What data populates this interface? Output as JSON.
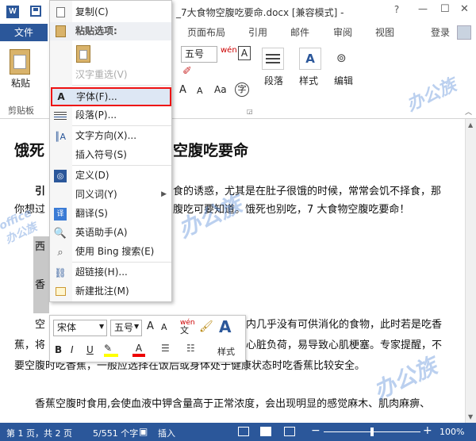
{
  "window": {
    "title": "_7大食物空腹吃要命.docx [兼容模式] -",
    "help": "?",
    "controls": [
      "—",
      "☐",
      "✕"
    ]
  },
  "quick_access": {
    "save_icon": "save-icon",
    "word_logo": "W"
  },
  "tabs": {
    "file": "文件",
    "layout": "页面布局",
    "references": "引用",
    "mailings": "邮件",
    "review": "审阅",
    "view": "视图",
    "login": "登录"
  },
  "ribbon": {
    "paste": "粘贴",
    "clipboard": "剪贴板",
    "font_size": "五号",
    "paragraph": "段落",
    "styles": "样式",
    "editing": "编辑"
  },
  "document": {
    "heading_left": "饿死",
    "heading_right": "空腹吃要命",
    "p1_start": "引",
    "p1_line1": "食的诱惑，尤其是在肚子很饿的时候，常常会饥不择食，那",
    "p1_line2_left": "你想过",
    "p1_line2_right": "腹吃可要知道。饿死也别吃，7 大食物空腹吃要命！",
    "item1": "西",
    "item2": "香",
    "p2_line1_left": "空",
    "p2_line1_right": "内几乎没有可供消化的食物，此时若是吃香",
    "p2_line2_left": "蕉，将",
    "p2_line2_right": "心脏负荷，易导致心肌梗塞。专家提醒，不",
    "p2_line3": "要空腹时吃香蕉，一般应选择在饭后或身体处于健康状态时吃香蕉比较安全。",
    "p3": "香蕉空腹时食用,会使血液中钾含量高于正常浓度，会出现明显的感觉麻木、肌肉麻痹、"
  },
  "context_menu": {
    "items": [
      {
        "label": "复制(C)",
        "icon": "copy-icon",
        "enabled": true
      },
      {
        "label": "粘贴选项:",
        "icon": "paste-icon",
        "enabled": true,
        "bold": true
      },
      {
        "label": "汉字重选(V)",
        "icon": "",
        "enabled": false
      },
      {
        "label": "字体(F)...",
        "icon": "font-icon",
        "enabled": true,
        "highlighted": true
      },
      {
        "label": "段落(P)...",
        "icon": "paragraph-icon",
        "enabled": true
      },
      {
        "label": "文字方向(X)...",
        "icon": "text-direction-icon",
        "enabled": true
      },
      {
        "label": "插入符号(S)",
        "icon": "",
        "enabled": true
      },
      {
        "label": "定义(D)",
        "icon": "define-icon",
        "enabled": true
      },
      {
        "label": "同义词(Y)",
        "icon": "",
        "enabled": true,
        "submenu": true
      },
      {
        "label": "翻译(S)",
        "icon": "translate-icon",
        "enabled": true
      },
      {
        "label": "英语助手(A)",
        "icon": "english-assistant-icon",
        "enabled": true
      },
      {
        "label": "使用 Bing 搜索(E)",
        "icon": "bing-search-icon",
        "enabled": true
      },
      {
        "label": "超链接(H)...",
        "icon": "hyperlink-icon",
        "enabled": true
      },
      {
        "label": "新建批注(M)",
        "icon": "new-comment-icon",
        "enabled": true
      }
    ]
  },
  "mini_toolbar": {
    "font_name": "宋体",
    "font_size": "五号",
    "bold": "B",
    "italic": "I",
    "underline": "U",
    "styles": "样式"
  },
  "status": {
    "page": "第 1 页，共 2 页",
    "words": "5/551 个字",
    "mode": "插入",
    "zoom": "100%"
  }
}
